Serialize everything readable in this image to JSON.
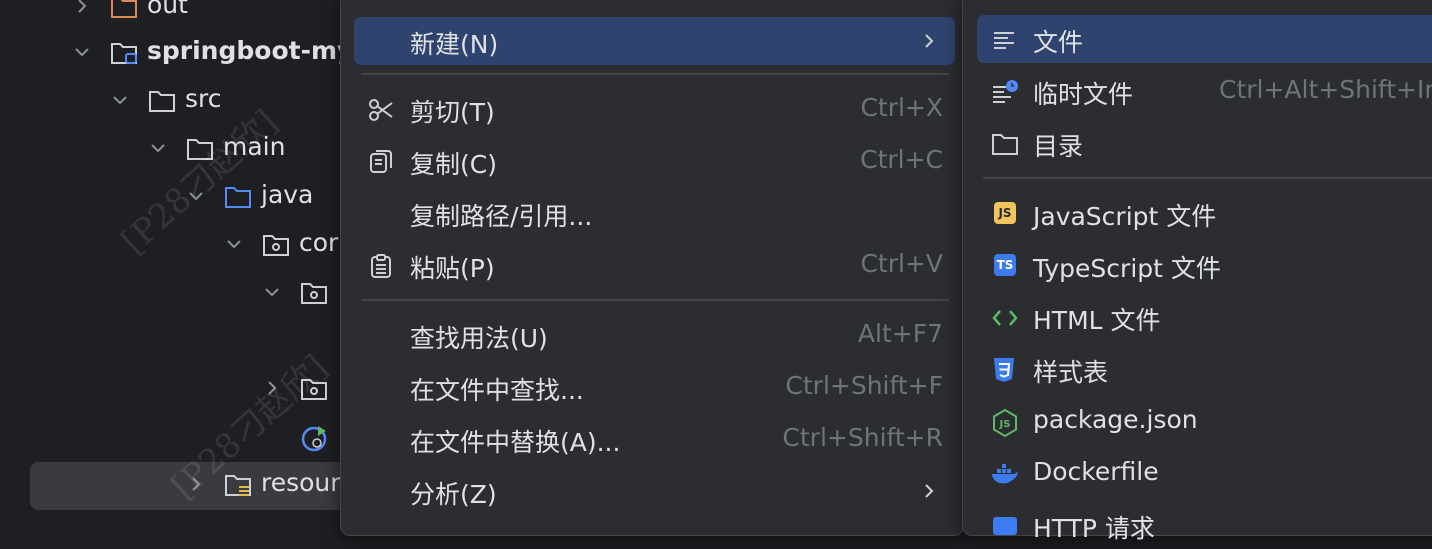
{
  "tree": {
    "items": [
      {
        "label": "out"
      },
      {
        "label": "springboot-my"
      },
      {
        "label": "src"
      },
      {
        "label": "main"
      },
      {
        "label": "java"
      },
      {
        "label": "cor"
      },
      {
        "label": ""
      },
      {
        "label": ""
      },
      {
        "label": ""
      },
      {
        "label": "resour"
      }
    ],
    "watermark_1": "[P28刁赵欣]",
    "watermark_2": "[P28刁赵欣]"
  },
  "context_menu": {
    "items": [
      {
        "label": "新建(N)",
        "mnemonic": "N",
        "shortcut": "",
        "submenu": true
      },
      {
        "label": "剪切(T)",
        "mnemonic": "T",
        "shortcut": "Ctrl+X"
      },
      {
        "label": "复制(C)",
        "mnemonic": "C",
        "shortcut": "Ctrl+C"
      },
      {
        "label": "复制路径/引用...",
        "mnemonic": "",
        "shortcut": ""
      },
      {
        "label": "粘贴(P)",
        "mnemonic": "P",
        "shortcut": "Ctrl+V"
      },
      {
        "label": "查找用法(U)",
        "mnemonic": "U",
        "shortcut": "Alt+F7"
      },
      {
        "label": "在文件中查找...",
        "mnemonic": "",
        "shortcut": "Ctrl+Shift+F"
      },
      {
        "label": "在文件中替换(A)...",
        "mnemonic": "A",
        "shortcut": "Ctrl+Shift+R"
      },
      {
        "label": "分析(Z)",
        "mnemonic": "Z",
        "shortcut": "",
        "submenu": true
      }
    ]
  },
  "new_menu": {
    "items": [
      {
        "label": "文件",
        "shortcut": "",
        "icon": "file-lines-icon"
      },
      {
        "label": "临时文件",
        "shortcut": "Ctrl+Alt+Shift+Ir",
        "icon": "scratch-file-icon"
      },
      {
        "label": "目录",
        "shortcut": "",
        "icon": "folder-icon"
      },
      {
        "label": "JavaScript 文件",
        "shortcut": "",
        "icon": "javascript-icon",
        "badge": "JS"
      },
      {
        "label": "TypeScript 文件",
        "shortcut": "",
        "icon": "typescript-icon",
        "badge": "TS"
      },
      {
        "label": "HTML 文件",
        "shortcut": "",
        "icon": "html-icon"
      },
      {
        "label": "样式表",
        "shortcut": "",
        "icon": "css-icon"
      },
      {
        "label": "package.json",
        "shortcut": "",
        "icon": "nodejs-icon"
      },
      {
        "label": "Dockerfile",
        "shortcut": "",
        "icon": "docker-icon"
      },
      {
        "label": "HTTP 请求",
        "shortcut": "",
        "icon": "http-icon"
      }
    ]
  },
  "colors": {
    "background": "#1e1f22",
    "menu_bg": "#2b2d30",
    "selection": "#2e436e",
    "text": "#dfe1e5",
    "shortcut_text": "#6f737a",
    "folder_blue": "#548af7",
    "js_yellow": "#f2c55c",
    "ts_blue": "#3d7bf0"
  }
}
